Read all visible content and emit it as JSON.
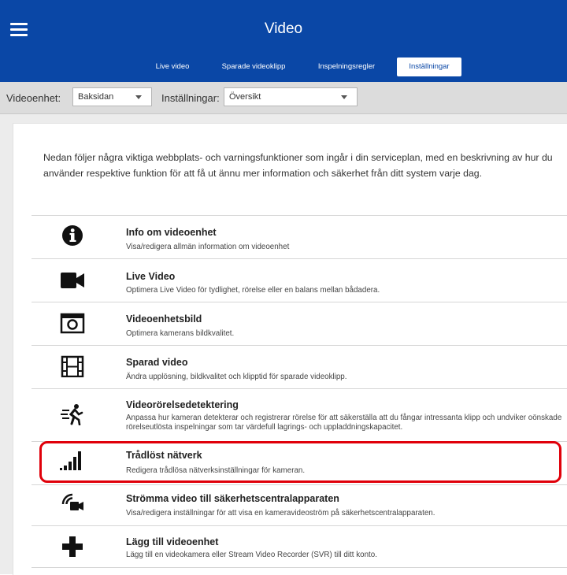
{
  "header": {
    "title": "Video",
    "tabs": [
      {
        "label": "Live video",
        "active": false
      },
      {
        "label": "Sparade videoklipp",
        "active": false
      },
      {
        "label": "Inspelningsregler",
        "active": false
      },
      {
        "label": "Inställningar",
        "active": true
      }
    ]
  },
  "filters": {
    "device_label": "Videoenhet:",
    "device_value": "Baksidan",
    "settings_label": "Inställningar:",
    "settings_value": "Översikt"
  },
  "intro": "Nedan följer några viktiga webbplats- och varningsfunktioner som ingår i din serviceplan, med en beskrivning av hur du använder respektive funktion för att få ut ännu mer information och säkerhet från ditt system varje dag.",
  "items": [
    {
      "icon": "info-icon",
      "title": "Info om videoenhet",
      "desc": "Visa/redigera allmän information om videoenhet"
    },
    {
      "icon": "video-camera-icon",
      "title": "Live Video",
      "desc": "Optimera Live Video för tydlighet, rörelse eller en balans mellan bådadera."
    },
    {
      "icon": "camera-icon",
      "title": "Videoenhetsbild",
      "desc": "Optimera kamerans bildkvalitet."
    },
    {
      "icon": "film-icon",
      "title": "Sparad video",
      "desc": "Ändra upplösning, bildkvalitet och klipptid för sparade videoklipp."
    },
    {
      "icon": "motion-icon",
      "title": "Videorörelsedetektering",
      "desc": "Anpassa hur kameran detekterar och registrerar rörelse för att säkerställa att du fångar intressanta klipp och undviker oönskade rörelseutlösta inspelningar som tar värdefull lagrings- och uppladdningskapacitet."
    },
    {
      "icon": "signal-bars-icon",
      "title": "Trådlöst nätverk",
      "desc": "Redigera trådlösa nätverksinställningar för kameran.",
      "highlighted": true
    },
    {
      "icon": "stream-camera-icon",
      "title": "Strömma video till säkerhetscentralapparaten",
      "desc": "Visa/redigera inställningar för att visa en kameravideoström på säkerhetscentralapparaten."
    },
    {
      "icon": "plus-icon",
      "title": "Lägg till videoenhet",
      "desc": "Lägg till en videokamera eller Stream Video Recorder (SVR) till ditt konto."
    }
  ],
  "colors": {
    "header": "#0a47a6",
    "highlight": "#e0000a"
  }
}
